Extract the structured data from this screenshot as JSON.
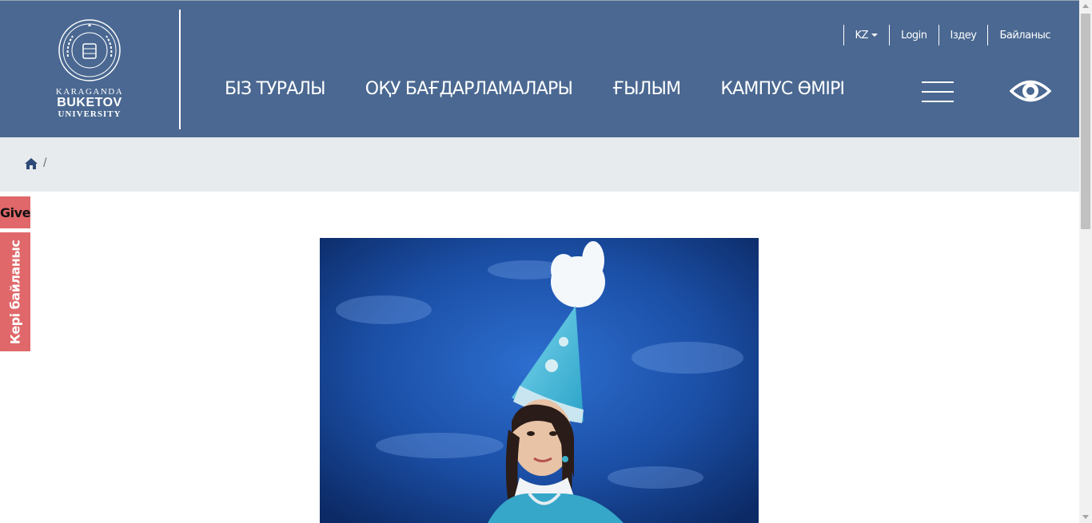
{
  "brand": {
    "line1": "KARAGANDA",
    "line2": "BUKETOV",
    "line3": "UNIVERSITY"
  },
  "topbar": {
    "lang": "KZ",
    "login": "Login",
    "search": "Іздеу",
    "contacts": "Байланыс"
  },
  "nav": [
    {
      "label": "БІЗ ТУРАЛЫ"
    },
    {
      "label": "ОҚУ БАҒДАРЛАМАЛАРЫ"
    },
    {
      "label": "ҒЫЛЫМ"
    },
    {
      "label": "КАМПУС ӨМІРІ"
    }
  ],
  "breadcrumb": {
    "separator": "/"
  },
  "side": {
    "give": "Give",
    "feedback": "Кері байланыс"
  },
  "icons": {
    "home": "home-icon",
    "menu": "hamburger-menu-icon",
    "eye": "eye-icon",
    "caret": "caret-down-icon"
  },
  "colors": {
    "header_bg": "#4a6891",
    "breadcrumb_bg": "#e8ebee",
    "side_tab_bg": "#e0686a",
    "home_icon": "#2e4a78"
  }
}
